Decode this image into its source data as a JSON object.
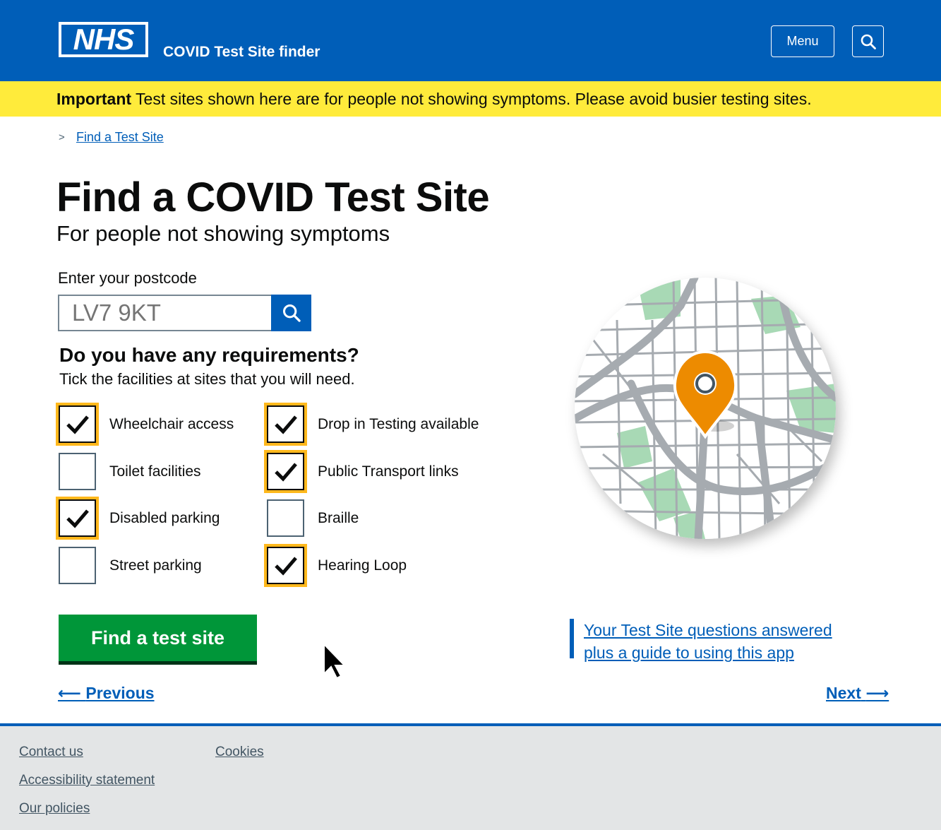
{
  "header": {
    "logo_text": "NHS",
    "service_name": "COVID Test Site finder",
    "menu_label": "Menu",
    "brand_color": "#005eb8"
  },
  "banner": {
    "strong": "Important",
    "text": " Test sites shown here are for people not showing symptoms. Please avoid busier testing sites.",
    "color": "#ffeb3b"
  },
  "breadcrumb": {
    "chevron": ">",
    "link": "Find a Test Site"
  },
  "page": {
    "title": "Find a COVID Test Site",
    "subtitle": "For people not showing symptoms"
  },
  "postcode": {
    "label": "Enter your postcode",
    "placeholder": "LV7 9KT"
  },
  "requirements": {
    "title": "Do you have any requirements?",
    "hint": "Tick the facilities at sites that you will need.",
    "options": [
      {
        "label": "Wheelchair access",
        "checked": true
      },
      {
        "label": "Toilet facilities",
        "checked": false
      },
      {
        "label": "Disabled parking",
        "checked": true
      },
      {
        "label": "Street parking",
        "checked": false
      },
      {
        "label": "Drop in Testing available",
        "checked": true
      },
      {
        "label": "Public Transport links",
        "checked": true
      },
      {
        "label": "Braille",
        "checked": false
      },
      {
        "label": "Hearing Loop",
        "checked": true
      }
    ]
  },
  "actions": {
    "primary": "Find a test site",
    "help_line1": "Your Test Site questions answered",
    "help_line2": "plus a guide to using this app",
    "previous": "Previous",
    "next": "Next",
    "prev_arrow": "⟵",
    "next_arrow": "⟶"
  },
  "map": {
    "pin_color": "#ed8b00",
    "park_color": "#a8d9b5"
  },
  "footer": {
    "links": [
      "Contact us",
      "Accessibility statement",
      "Our policies",
      "Cookies"
    ]
  }
}
